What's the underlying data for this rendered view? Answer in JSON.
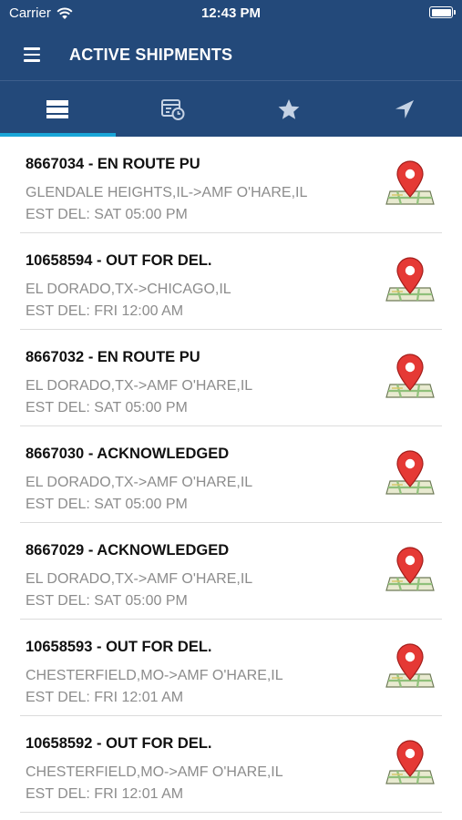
{
  "status_bar": {
    "carrier": "Carrier",
    "time": "12:43 PM"
  },
  "nav": {
    "title": "ACTIVE SHIPMENTS"
  },
  "tabs": [
    {
      "name": "list-icon"
    },
    {
      "name": "calendar-clock-icon"
    },
    {
      "name": "star-icon"
    },
    {
      "name": "navigation-arrow-icon"
    }
  ],
  "colors": {
    "header": "#23497a",
    "tab_active": "#19a6d8",
    "pin": "#e53935"
  },
  "shipments": [
    {
      "title": "8667034 - EN ROUTE PU",
      "route": "GLENDALE HEIGHTS,IL->AMF O'HARE,IL",
      "est": "EST DEL: SAT 05:00 PM"
    },
    {
      "title": "10658594 - OUT FOR DEL.",
      "route": "EL DORADO,TX->CHICAGO,IL",
      "est": "EST DEL: FRI 12:00 AM"
    },
    {
      "title": "8667032 - EN ROUTE PU",
      "route": "EL DORADO,TX->AMF O'HARE,IL",
      "est": "EST DEL: SAT 05:00 PM"
    },
    {
      "title": "8667030 - ACKNOWLEDGED",
      "route": "EL DORADO,TX->AMF O'HARE,IL",
      "est": "EST DEL: SAT 05:00 PM"
    },
    {
      "title": "8667029 - ACKNOWLEDGED",
      "route": "EL DORADO,TX->AMF O'HARE,IL",
      "est": "EST DEL: SAT 05:00 PM"
    },
    {
      "title": "10658593 - OUT FOR DEL.",
      "route": "CHESTERFIELD,MO->AMF O'HARE,IL",
      "est": "EST DEL: FRI 12:01 AM"
    },
    {
      "title": "10658592 - OUT FOR DEL.",
      "route": "CHESTERFIELD,MO->AMF O'HARE,IL",
      "est": "EST DEL: FRI 12:01 AM"
    }
  ]
}
